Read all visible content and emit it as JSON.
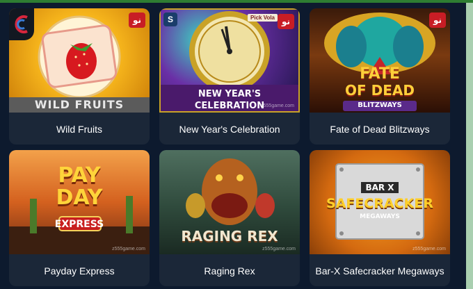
{
  "games": [
    {
      "name": "Wild Fruits",
      "art_title": "WILD FRUITS",
      "new_badge": "نو"
    },
    {
      "name": "New Year's Celebration",
      "art_title_line1": "NEW YEAR'S",
      "art_title_line2": "CELEBRATION",
      "new_badge": "نو",
      "pick_label": "Pick Vola",
      "provider_letter": "S",
      "watermark": "z555game.com"
    },
    {
      "name": "Fate of Dead Blitzways",
      "art_title_line1": "FATE",
      "art_title_line2": "OF DEAD",
      "art_title_line3": "BLITZWAYS",
      "new_badge": "نو"
    },
    {
      "name": "Payday Express",
      "art_title_line1": "PAY",
      "art_title_line2": "DAY",
      "art_title_line3": "EXPRESS",
      "watermark": "z555game.com"
    },
    {
      "name": "Raging Rex",
      "art_title": "RAGING REX",
      "watermark": "z555game.com"
    },
    {
      "name": "Bar-X Safecracker Megaways",
      "art_title_line1": "BAR X",
      "art_title_line2": "SAFECRACKER",
      "art_title_line3": "MEGAWAYS",
      "watermark": "z555game.com"
    }
  ],
  "colors": {
    "page_bg": "#0d1a2e",
    "card_bg": "#1b2738",
    "badge_red": "#c81d25",
    "top_accent": "#2e7d32"
  }
}
